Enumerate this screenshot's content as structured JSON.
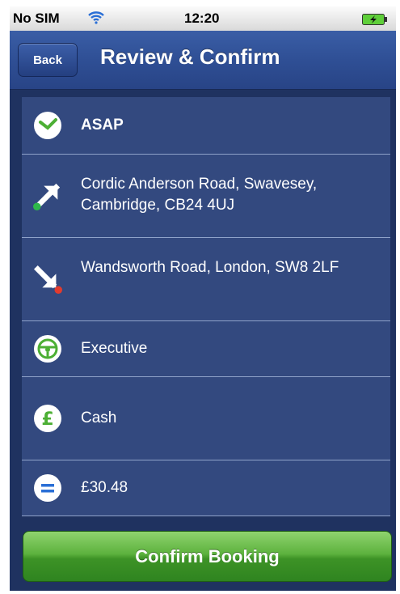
{
  "status_bar": {
    "carrier": "No SIM",
    "time": "12:20",
    "wifi_icon": "wifi-icon",
    "battery_icon": "battery-charging-icon"
  },
  "nav": {
    "back_label": "Back",
    "title": "Review & Confirm"
  },
  "rows": [
    {
      "label": "ASAP",
      "icon": "clock-icon"
    },
    {
      "label": "Cordic Anderson Road, Swavesey, Cambridge, CB24 4UJ",
      "icon": "pickup-arrow-icon"
    },
    {
      "label": "Wandsworth Road, London, SW8 2LF",
      "icon": "dropoff-arrow-icon"
    },
    {
      "label": "Executive",
      "icon": "steering-wheel-icon"
    },
    {
      "label": "Cash",
      "icon": "pound-icon"
    },
    {
      "label": "£30.48",
      "icon": "equals-icon"
    }
  ],
  "confirm_label": "Confirm Booking",
  "colors": {
    "nav": "#2f4f95",
    "row_bg": "#33497f",
    "accent_green": "#4caf34",
    "pickup_dot": "#2eb84a",
    "dropoff_dot": "#e23b2e"
  }
}
